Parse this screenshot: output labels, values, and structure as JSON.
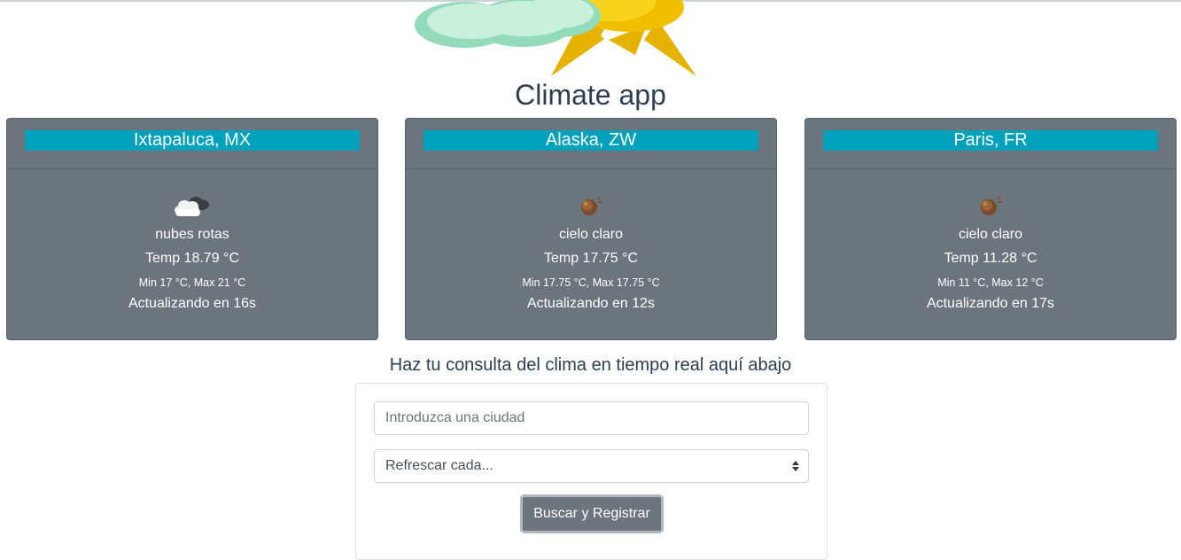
{
  "app": {
    "title": "Climate app"
  },
  "cards": [
    {
      "city": "Ixtapaluca, MX",
      "icon": "broken-clouds-icon",
      "description": "nubes rotas",
      "temp": "Temp 18.79 °C",
      "minmax": "Min 17 °C, Max 21 °C",
      "update": "Actualizando en 16s"
    },
    {
      "city": "Alaska, ZW",
      "icon": "clear-sky-night-icon",
      "description": "cielo claro",
      "temp": "Temp 17.75 °C",
      "minmax": "Min 17.75 °C, Max 17.75 °C",
      "update": "Actualizando en 12s"
    },
    {
      "city": "Paris, FR",
      "icon": "clear-sky-night-icon",
      "description": "cielo claro",
      "temp": "Temp 11.28 °C",
      "minmax": "Min 11 °C, Max 12 °C",
      "update": "Actualizando en 17s"
    }
  ],
  "query": {
    "subtitle": "Haz tu consulta del clima en tiempo real aquí abajo",
    "city_value": "",
    "city_placeholder": "Introduzca una ciudad",
    "refresh_selected": "Refrescar cada...",
    "submit_label": "Buscar y Registrar"
  },
  "colors": {
    "card_bg": "#6c757d",
    "city_bar": "#00a1ba",
    "title": "#2c3e50",
    "button": "#6c757d"
  }
}
